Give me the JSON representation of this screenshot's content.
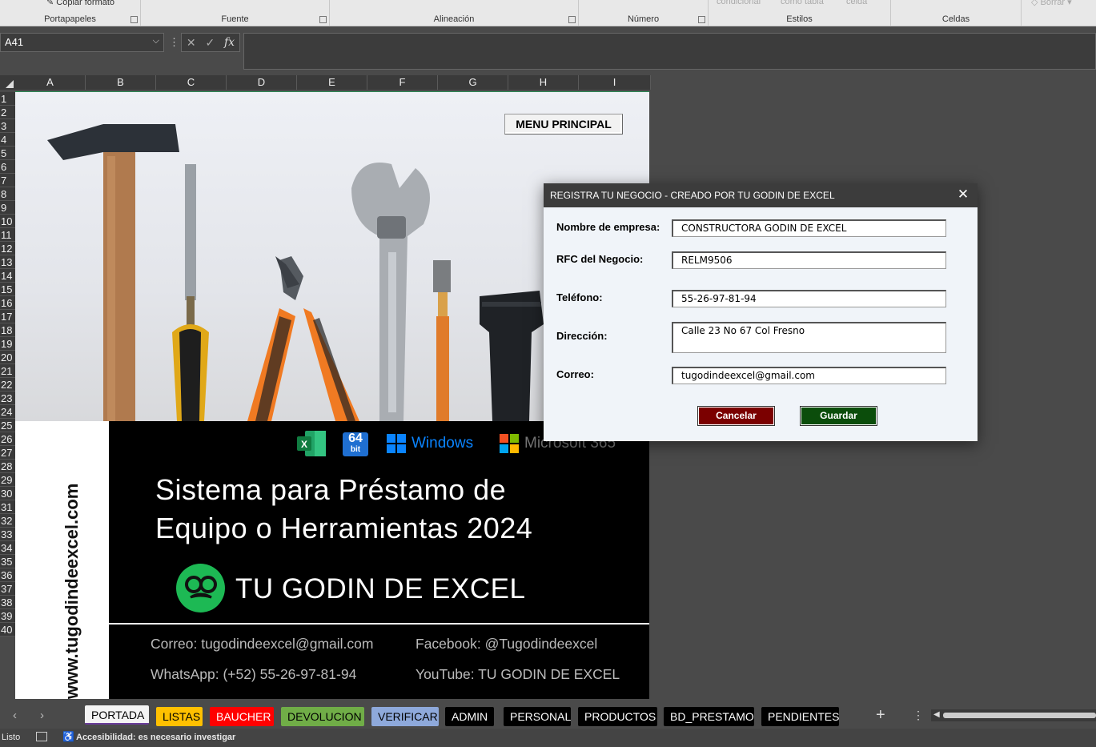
{
  "ribbon": {
    "groups": [
      {
        "label": "Portapapeles"
      },
      {
        "label": "Fuente"
      },
      {
        "label": "Alineación"
      },
      {
        "label": "Número"
      },
      {
        "label": "Estilos"
      },
      {
        "label": "Celdas"
      }
    ],
    "copy_format": "Copiar formato",
    "cond_format": "condicional",
    "as_table": "como tabla",
    "cell": "celda",
    "clear": "Borrar"
  },
  "formula_bar": {
    "name_box": "A41",
    "value": ""
  },
  "columns": [
    "A",
    "B",
    "C",
    "D",
    "E",
    "F",
    "G",
    "H",
    "I"
  ],
  "rows": [
    "1",
    "2",
    "3",
    "4",
    "5",
    "6",
    "7",
    "8",
    "9",
    "10",
    "11",
    "12",
    "13",
    "14",
    "15",
    "16",
    "17",
    "18",
    "19",
    "20",
    "21",
    "22",
    "23",
    "24",
    "25",
    "26",
    "27",
    "28",
    "29",
    "30",
    "31",
    "32",
    "33",
    "34",
    "35",
    "36",
    "37",
    "38",
    "39",
    "40"
  ],
  "sheet": {
    "menu_button": "MENU PRINCIPAL",
    "website": "www.tugodindeexcel.com",
    "logos": {
      "bit": "64",
      "bit_label": "bit",
      "windows": "Windows",
      "microsoft": "Microsoft 365"
    },
    "title_line1": "Sistema para Préstamo de",
    "title_line2": "Equipo o Herramientas 2024",
    "brand": "TU GODIN DE EXCEL",
    "email": "Correo: tugodindeexcel@gmail.com",
    "facebook": "Facebook: @Tugodindeexcel",
    "whatsapp": "WhatsApp: (+52) 55-26-97-81-94",
    "youtube": "YouTube: TU GODIN DE EXCEL"
  },
  "dialog": {
    "title": "REGISTRA TU NEGOCIO - CREADO POR TU GODIN DE EXCEL",
    "fields": [
      {
        "label": "Nombre de empresa:",
        "value": "CONSTRUCTORA GODIN DE EXCEL"
      },
      {
        "label": "RFC del Negocio:",
        "value": "RELM9506"
      },
      {
        "label": "Teléfono:",
        "value": "55-26-97-81-94"
      },
      {
        "label": "Dirección:",
        "value": "Calle 23 No 67 Col Fresno"
      },
      {
        "label": "Correo:",
        "value": "tugodindeexcel@gmail.com"
      }
    ],
    "cancel": "Cancelar",
    "save": "Guardar",
    "cancel_color": "#7b0000",
    "save_color": "#0b4d0b"
  },
  "tabs": [
    {
      "label": "PORTADA",
      "bg": "#f4f4f4",
      "fg": "#000000",
      "active": true
    },
    {
      "label": "LISTAS",
      "bg": "#ffc000",
      "fg": "#000000"
    },
    {
      "label": "BAUCHER",
      "bg": "#ff0000",
      "fg": "#ffffff"
    },
    {
      "label": "DEVOLUCION",
      "bg": "#70ad47",
      "fg": "#000000"
    },
    {
      "label": "VERIFICAR",
      "bg": "#8ea9db",
      "fg": "#000000"
    },
    {
      "label": "ADMIN",
      "bg": "#000000",
      "fg": "#ffffff"
    },
    {
      "label": "PERSONAL",
      "bg": "#000000",
      "fg": "#ffffff"
    },
    {
      "label": "PRODUCTOS",
      "bg": "#000000",
      "fg": "#ffffff"
    },
    {
      "label": "BD_PRESTAMO",
      "bg": "#000000",
      "fg": "#ffffff"
    },
    {
      "label": "PENDIENTES",
      "bg": "#000000",
      "fg": "#ffffff"
    }
  ],
  "status": {
    "ready": "Listo",
    "accessibility": "Accesibilidad: es necesario investigar"
  }
}
